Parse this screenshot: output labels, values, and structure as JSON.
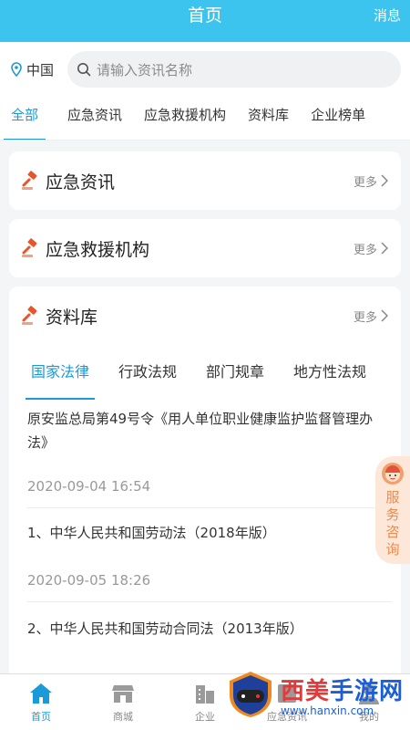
{
  "header": {
    "title": "首页",
    "message_label": "消息"
  },
  "location": {
    "label": "中国"
  },
  "search": {
    "placeholder": "请输入资讯名称"
  },
  "tabs": [
    {
      "label": "全部"
    },
    {
      "label": "应急资讯"
    },
    {
      "label": "应急救援机构"
    },
    {
      "label": "资料库"
    },
    {
      "label": "企业榜单"
    }
  ],
  "sections": {
    "news": {
      "title": "应急资讯",
      "more": "更多"
    },
    "rescue": {
      "title": "应急救援机构",
      "more": "更多"
    },
    "library": {
      "title": "资料库",
      "more": "更多",
      "subtabs": [
        {
          "label": "国家法律"
        },
        {
          "label": "行政法规"
        },
        {
          "label": "部门规章"
        },
        {
          "label": "地方性法规"
        }
      ],
      "items": [
        {
          "title": "原安监总局第49号令《用人单位职业健康监护监督管理办法》",
          "date": "2020-09-04 16:54"
        },
        {
          "title": "1、中华人民共和国劳动法（2018年版）",
          "date": "2020-09-05 18:26"
        },
        {
          "title": "2、中华人民共和国劳动合同法（2013年版）",
          "date": ""
        }
      ]
    }
  },
  "float_button": {
    "label": "服务咨询"
  },
  "bottom_nav": [
    {
      "label": "首页"
    },
    {
      "label": "商城"
    },
    {
      "label": "企业"
    },
    {
      "label": "应急资讯"
    },
    {
      "label": "我的"
    }
  ],
  "watermark": {
    "text": "西美手游网",
    "url": "www.hanxin.com"
  },
  "colors": {
    "primary": "#3cc4ee",
    "accent": "#1a9ad9",
    "float_bg": "#fde7d8",
    "float_text": "#f08a4b"
  }
}
